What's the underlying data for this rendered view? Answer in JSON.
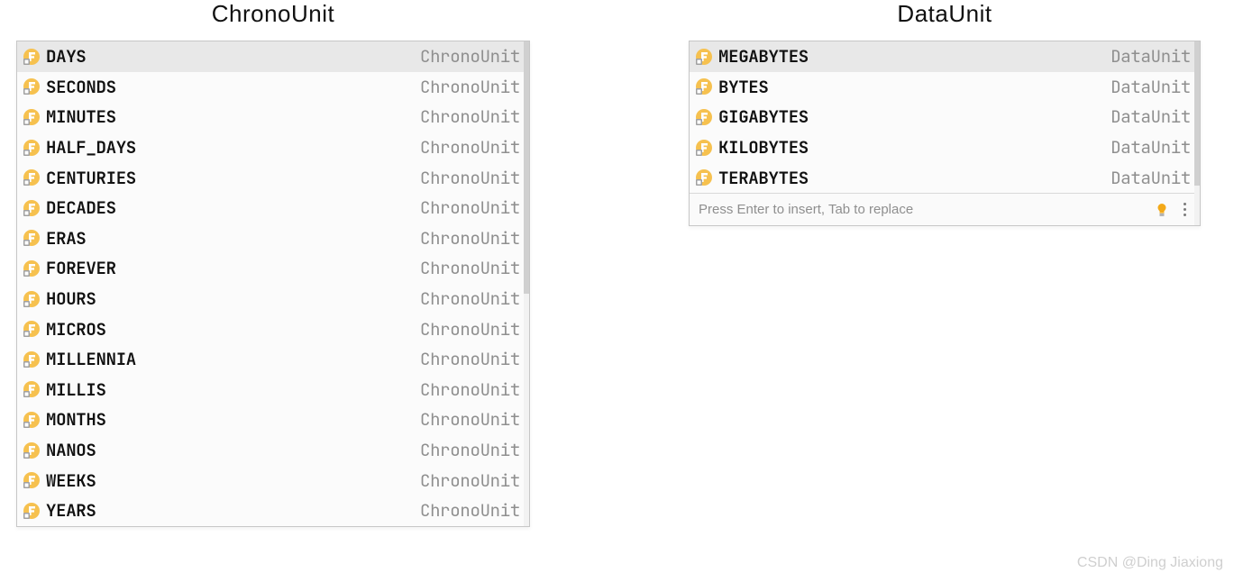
{
  "left": {
    "heading": "ChronoUnit",
    "type_label": "ChronoUnit",
    "items": [
      "DAYS",
      "SECONDS",
      "MINUTES",
      "HALF_DAYS",
      "CENTURIES",
      "DECADES",
      "ERAS",
      "FOREVER",
      "HOURS",
      "MICROS",
      "MILLENNIA",
      "MILLIS",
      "MONTHS",
      "NANOS",
      "WEEKS",
      "YEARS"
    ]
  },
  "right": {
    "heading": "DataUnit",
    "type_label": "DataUnit",
    "items": [
      "MEGABYTES",
      "BYTES",
      "GIGABYTES",
      "KILOBYTES",
      "TERABYTES"
    ],
    "footer_hint": "Press Enter to insert, Tab to replace"
  },
  "icon_name": "field-icon",
  "watermark": "CSDN @Ding Jiaxiong"
}
